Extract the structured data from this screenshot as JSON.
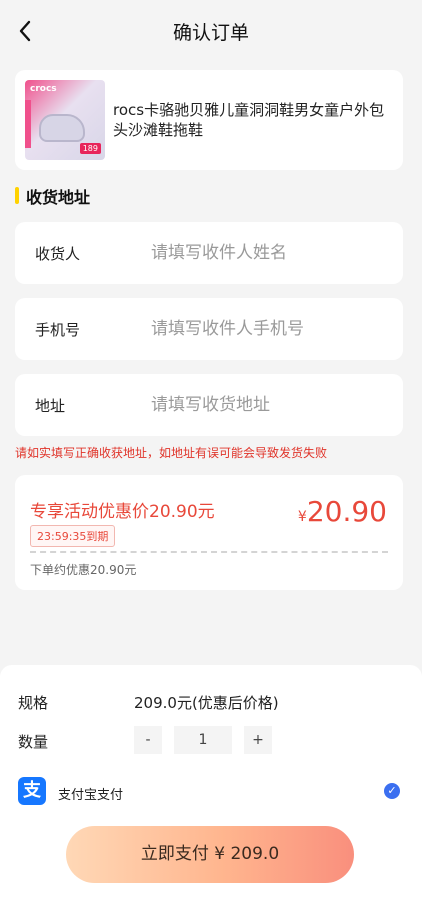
{
  "header": {
    "title": "确认订单",
    "back_icon": "back-arrow-icon"
  },
  "product": {
    "name": "rocs卡骆驰贝雅儿童洞洞鞋男女童户外包头沙滩鞋拖鞋",
    "image": {
      "brand_text": "crocs",
      "tag_text": "189"
    }
  },
  "address_section": {
    "title": "收货地址",
    "accent_color": "#ffd200",
    "fields": [
      {
        "label": "收货人",
        "placeholder": "请填写收件人姓名",
        "value": ""
      },
      {
        "label": "手机号",
        "placeholder": "请填写收件人手机号",
        "value": ""
      },
      {
        "label": "地址",
        "placeholder": "请填写收货地址",
        "value": ""
      }
    ],
    "warning": "请如实填写正确收获地址，如地址有误可能会导致发货失败"
  },
  "promo": {
    "title": "专享活动优惠价20.90元",
    "timer": "23:59:35到期",
    "currency": "¥",
    "price": "20.90",
    "note": "下单约优惠20.90元",
    "accent_color": "#e8483a"
  },
  "order": {
    "spec_label": "规格",
    "spec_value": "209.0元(优惠后价格)",
    "qty_label": "数量",
    "qty_minus": "-",
    "qty_value": "1",
    "qty_plus": "+",
    "payment": {
      "icon_glyph": "支",
      "label": "支付宝支付",
      "selected": true,
      "check_glyph": "✓"
    },
    "pay_button": "立即支付 ¥ 209.0"
  }
}
